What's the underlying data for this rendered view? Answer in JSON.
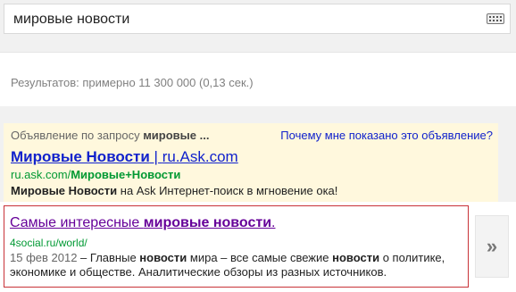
{
  "search": {
    "query": "мировые новости"
  },
  "stats": {
    "text": "Результатов: примерно 11 300 000 (0,13 сек.)"
  },
  "ad": {
    "label_prefix": "Объявление по запросу ",
    "label_query": "мировые ...",
    "why_link": "Почему мне показано это объявление?",
    "title_bold": "Мировые Новости",
    "title_sep": " | ",
    "title_domain": "ru.Ask.com",
    "url_plain": "ru.ask.com/",
    "url_bold": "Мировые+Новости",
    "snippet_bold": "Мировые Новости",
    "snippet_rest": " на Ask Интернет-поиск в мгновение ока!"
  },
  "result": {
    "title_plain": "Самые интересные ",
    "title_bold": "мировые новости",
    "title_end": ".",
    "url": "4social.ru/world/",
    "date": "15 фев 2012",
    "snippet_1": " – Главные ",
    "snippet_b1": "новости",
    "snippet_2": " мира – все самые свежие ",
    "snippet_b2": "новости",
    "snippet_3": " о политике, экономике и обществе. Аналитические обзоры из разных источников."
  },
  "expand": {
    "glyph": "»"
  },
  "colors": {
    "link": "#1122cc",
    "visited": "#660099",
    "url_green": "#009933",
    "ad_bg": "#fff8dd",
    "highlight_border": "#c83238"
  },
  "icons": {
    "keyboard": "keyboard-icon",
    "expand": "double-chevron-right-icon"
  }
}
